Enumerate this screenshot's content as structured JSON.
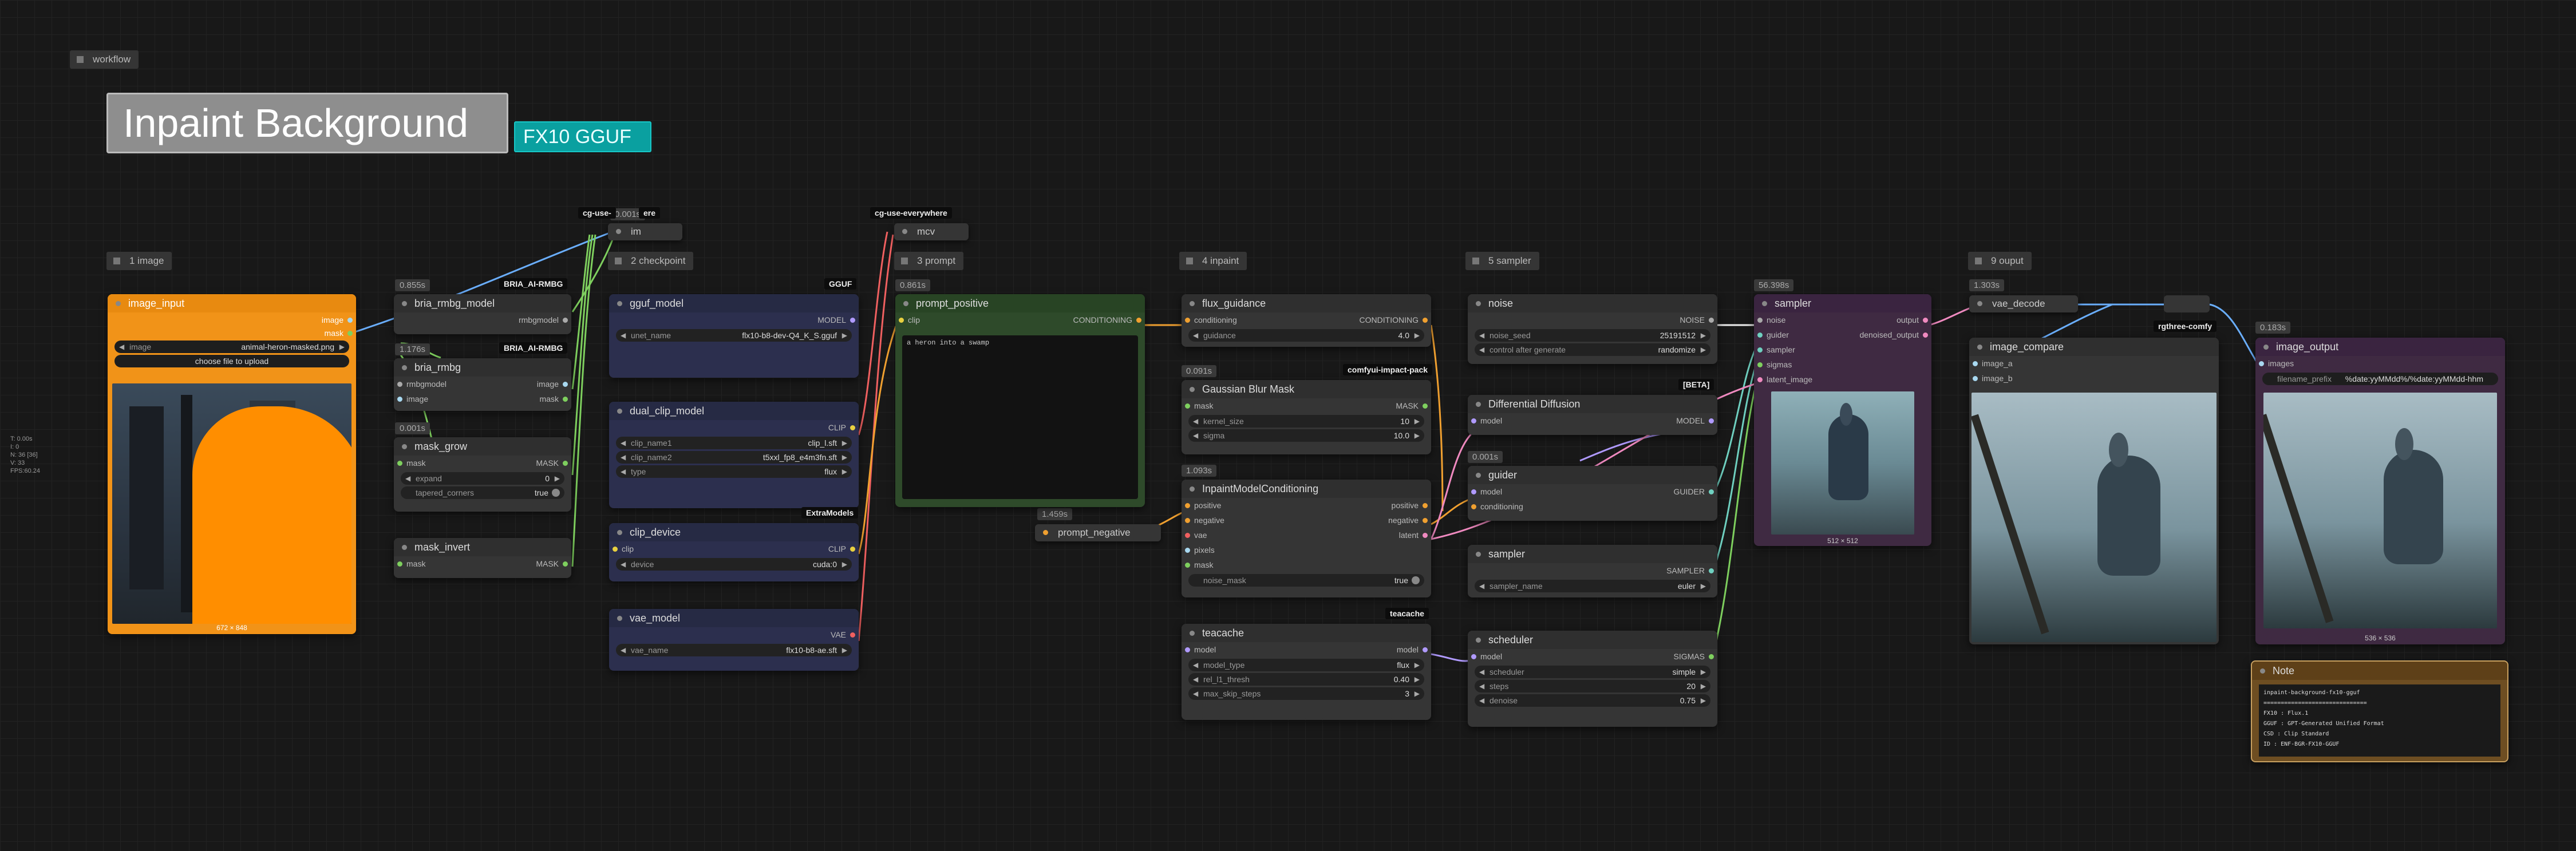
{
  "workflow_tag": "workflow",
  "header": {
    "title": "Inpaint Background",
    "subtitle": "FX10 GGUF"
  },
  "debug": [
    "T: 0.00s",
    "I: 0",
    "N: 36 [36]",
    "V: 33",
    "FPS:60.24"
  ],
  "groups": {
    "image": "1 image",
    "checkpoint": "2 checkpoint",
    "prompt": "3 prompt",
    "inpaint": "4 inpaint",
    "sampler": "5 sampler",
    "output": "9 ouput"
  },
  "badges": {
    "cg_use_left": "cg-use-",
    "cg_use_left_tail": "ere",
    "cg_use_everywhere": "cg-use-everywhere",
    "bria_1": "BRIA_AI-RMBG",
    "bria_2": "BRIA_AI-RMBG",
    "gguf": "GGUF",
    "extra_models": "ExtraModels",
    "impact_pack": "comfyui-impact-pack",
    "beta": "[BETA]",
    "teacache": "teacache",
    "rgthree": "rgthree-comfy"
  },
  "timers": {
    "im": "0.001s",
    "bria_model": "0.855s",
    "bria": "1.176s",
    "mask_grow": "0.001s",
    "prompt": "0.861s",
    "prompt_negative": "1.459s",
    "gaussian": "0.091s",
    "inpaint_cond": "1.093s",
    "guider": "0.001s",
    "sampler": "56.398s",
    "vae_decode": "1.303s",
    "image_output": "0.183s"
  },
  "nodes": {
    "image_input": {
      "title": "image_input",
      "outputs": [
        "image",
        "mask"
      ],
      "image_label": "image",
      "image_value": "animal-heron-masked.png",
      "upload_label": "choose file to upload",
      "caption": "672 × 848"
    },
    "bria_rmbg_model": {
      "title": "bria_rmbg_model",
      "output": "rmbgmodel"
    },
    "bria_rmbg": {
      "title": "bria_rmbg",
      "inputs": [
        "rmbgmodel",
        "image"
      ],
      "outputs": [
        "image",
        "mask"
      ]
    },
    "mask_grow": {
      "title": "mask_grow",
      "input": "mask",
      "output": "MASK",
      "expand_label": "expand",
      "expand_value": "0",
      "tapered_label": "tapered_corners",
      "tapered_value": "true"
    },
    "mask_invert": {
      "title": "mask_invert",
      "input": "mask",
      "output": "MASK"
    },
    "im": {
      "title": "im"
    },
    "mcv": {
      "title": "mcv"
    },
    "gguf_model": {
      "title": "gguf_model",
      "output": "MODEL",
      "unet_label": "unet_name",
      "unet_value": "flx10-b8-dev-Q4_K_S.gguf"
    },
    "dual_clip_model": {
      "title": "dual_clip_model",
      "output": "CLIP",
      "clip1_label": "clip_name1",
      "clip1_value": "clip_l.sft",
      "clip2_label": "clip_name2",
      "clip2_value": "t5xxl_fp8_e4m3fn.sft",
      "type_label": "type",
      "type_value": "flux"
    },
    "clip_device": {
      "title": "clip_device",
      "input": "clip",
      "output": "CLIP",
      "device_label": "device",
      "device_value": "cuda:0"
    },
    "vae_model": {
      "title": "vae_model",
      "output": "VAE",
      "vae_label": "vae_name",
      "vae_value": "flx10-b8-ae.sft"
    },
    "prompt_positive": {
      "title": "prompt_positive",
      "input": "clip",
      "output": "CONDITIONING",
      "text": "a heron into a swamp"
    },
    "prompt_negative": {
      "title": "prompt_negative"
    },
    "flux_guidance": {
      "title": "flux_guidance",
      "input": "conditioning",
      "output": "CONDITIONING",
      "guidance_label": "guidance",
      "guidance_value": "4.0"
    },
    "gaussian": {
      "title": "Gaussian Blur Mask",
      "input": "mask",
      "output": "MASK",
      "kernel_label": "kernel_size",
      "kernel_value": "10",
      "sigma_label": "sigma",
      "sigma_value": "10.0"
    },
    "inpaint_cond": {
      "title": "InpaintModelConditioning",
      "inputs": [
        "positive",
        "negative",
        "vae",
        "pixels",
        "mask"
      ],
      "outputs": [
        "positive",
        "negative",
        "latent"
      ],
      "noise_label": "noise_mask",
      "noise_value": "true"
    },
    "teacache": {
      "title": "teacache",
      "input": "model",
      "output": "model",
      "type_label": "model_type",
      "type_value": "flux",
      "thresh_label": "rel_l1_thresh",
      "thresh_value": "0.40",
      "skip_label": "max_skip_steps",
      "skip_value": "3"
    },
    "noise": {
      "title": "noise",
      "output": "NOISE",
      "seed_label": "noise_seed",
      "seed_value": "25191512",
      "control_label": "control after generate",
      "control_value": "randomize"
    },
    "diff_diffusion": {
      "title": "Differential Diffusion",
      "input": "model",
      "output": "MODEL"
    },
    "guider": {
      "title": "guider",
      "inputs": [
        "model",
        "conditioning"
      ],
      "output": "GUIDER"
    },
    "sampler_select": {
      "title": "sampler",
      "output": "SAMPLER",
      "name_label": "sampler_name",
      "name_value": "euler"
    },
    "scheduler": {
      "title": "scheduler",
      "input": "model",
      "output": "SIGMAS",
      "sched_label": "scheduler",
      "sched_value": "simple",
      "steps_label": "steps",
      "steps_value": "20",
      "denoise_label": "denoise",
      "denoise_value": "0.75"
    },
    "sampler": {
      "title": "sampler",
      "inputs": [
        "noise",
        "guider",
        "sampler",
        "sigmas",
        "latent_image"
      ],
      "outputs": [
        "output",
        "denoised_output"
      ],
      "caption": "512 × 512"
    },
    "vae_decode": {
      "title": "vae_decode"
    },
    "image_compare": {
      "title": "image_compare",
      "inputs": [
        "image_a",
        "image_b"
      ]
    },
    "image_output": {
      "title": "image_output",
      "input": "images",
      "prefix_label": "filename_prefix",
      "prefix_value": "%date:yyMMdd%/%date:yyMMdd-hhm",
      "caption": "536 × 536"
    },
    "note": {
      "title": "Note",
      "lines": [
        "inpaint-background-fx10-gguf",
        "==============================",
        "FX10 : Flux.1",
        "GGUF : GPT-Generated Unified Format",
        "CSD  : Clip Standard",
        "ID   : ENF-BGR-FX10-GGUF"
      ]
    }
  }
}
